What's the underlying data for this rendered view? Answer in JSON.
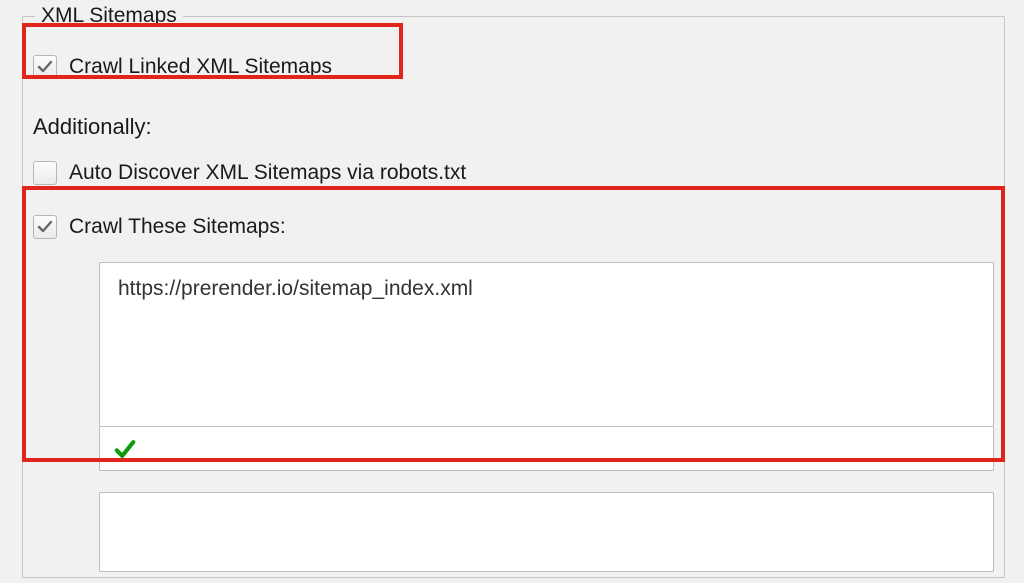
{
  "group": {
    "legend": "XML Sitemaps"
  },
  "options": {
    "crawl_linked": {
      "label": "Crawl Linked XML Sitemaps",
      "checked": true
    },
    "additionally_label": "Additionally:",
    "auto_discover": {
      "label": "Auto Discover XML Sitemaps via robots.txt",
      "checked": false
    },
    "crawl_these": {
      "label": "Crawl These Sitemaps:",
      "checked": true
    }
  },
  "sitemaps": {
    "value": "https://prerender.io/sitemap_index.xml",
    "valid": true
  },
  "colors": {
    "highlight": "#e0261c",
    "check_mark": "#666666",
    "valid_tick": "#0d9b0d"
  }
}
